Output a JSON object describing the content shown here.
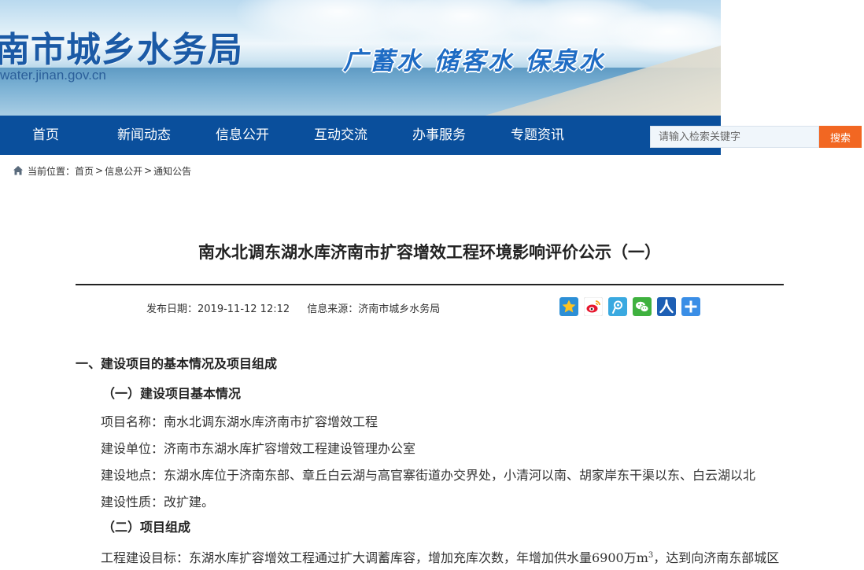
{
  "header": {
    "site_title": "南市城乡水务局",
    "site_url": "water.jinan.gov.cn",
    "slogan": "广蓄水  储客水  保泉水"
  },
  "nav": {
    "items": [
      {
        "label": "首页"
      },
      {
        "label": "新闻动态"
      },
      {
        "label": "信息公开"
      },
      {
        "label": "互动交流"
      },
      {
        "label": "办事服务"
      },
      {
        "label": "专题资讯"
      }
    ],
    "search": {
      "placeholder": "请输入检索关键字",
      "button": "搜索"
    }
  },
  "breadcrumb": {
    "prefix": "当前位置：",
    "items": [
      "首页",
      "信息公开",
      "通知公告"
    ],
    "separator": ">"
  },
  "article": {
    "title": "南水北调东湖水库济南市扩容增效工程环境影响评价公示（一）",
    "publish_date": "发布日期：2019-11-12 12:12",
    "source": "信息来源：济南市城乡水务局",
    "share_icons": [
      "qzone-icon",
      "weibo-icon",
      "tencent-weibo-icon",
      "wechat-icon",
      "renren-icon",
      "more-share-icon"
    ],
    "section1_heading": "一、建设项目的基本情况及项目组成",
    "sub1_heading": "（一）建设项目基本情况",
    "project_name": "项目名称：南水北调东湖水库济南市扩容增效工程",
    "builder": "建设单位：济南市东湖水库扩容增效工程建设管理办公室",
    "location": "建设地点：东湖水库位于济南东部、章丘白云湖与高官寨街道办交界处，小清河以南、胡家岸东干渠以东、白云湖以北",
    "nature": "建设性质：改扩建。",
    "sub2_heading": "（二）项目组成",
    "goal_prefix": "工程建设目标：东湖水库扩容增效工程通过扩大调蓄库容，增加充库次数，年增加供水量6900万m",
    "goal_sup": "3",
    "goal_suffix": "，达到向济南东部城区"
  },
  "colors": {
    "nav_bg": "#0a4f9c",
    "search_btn": "#f26722",
    "title_blue": "#1b5aa6"
  }
}
